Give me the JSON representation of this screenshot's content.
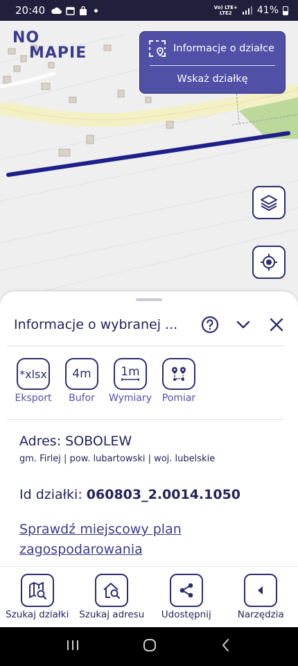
{
  "status_bar": {
    "time": "20:40",
    "network": "Vo) LTE+\nLTE2",
    "battery": "41%"
  },
  "map": {
    "logo_line1": "NO",
    "logo_line2": "MAPIE",
    "info_card": {
      "title": "Informacje o działce",
      "action": "Wskaż działkę"
    }
  },
  "sheet": {
    "title": "Informacje o wybranej ...",
    "tools": [
      {
        "icon_text": "*xlsx",
        "label": "Eksport"
      },
      {
        "icon_text": "4m",
        "label": "Bufor"
      },
      {
        "icon_text": "1m",
        "label": "Wymiary"
      },
      {
        "icon_text": "",
        "label": "Pomiar"
      }
    ],
    "address": "Adres: SOBOLEW",
    "admin": "gm. Firlej | pow. lubartowski | woj. lubelskie",
    "parcel_label": "Id działki: ",
    "parcel_id": "060803_2.0014.1050",
    "plan_link": "Sprawdź miejscowy plan zagospodarowania"
  },
  "bottom_nav": [
    {
      "label": "Szukaj działki"
    },
    {
      "label": "Szukaj adresu"
    },
    {
      "label": "Udostępnij"
    },
    {
      "label": "Narzędzia"
    }
  ],
  "colors": {
    "primary": "#2c2c6e",
    "accent": "#5050a6",
    "parcel_line": "#1f1f8a",
    "road": "#f2efc4"
  }
}
